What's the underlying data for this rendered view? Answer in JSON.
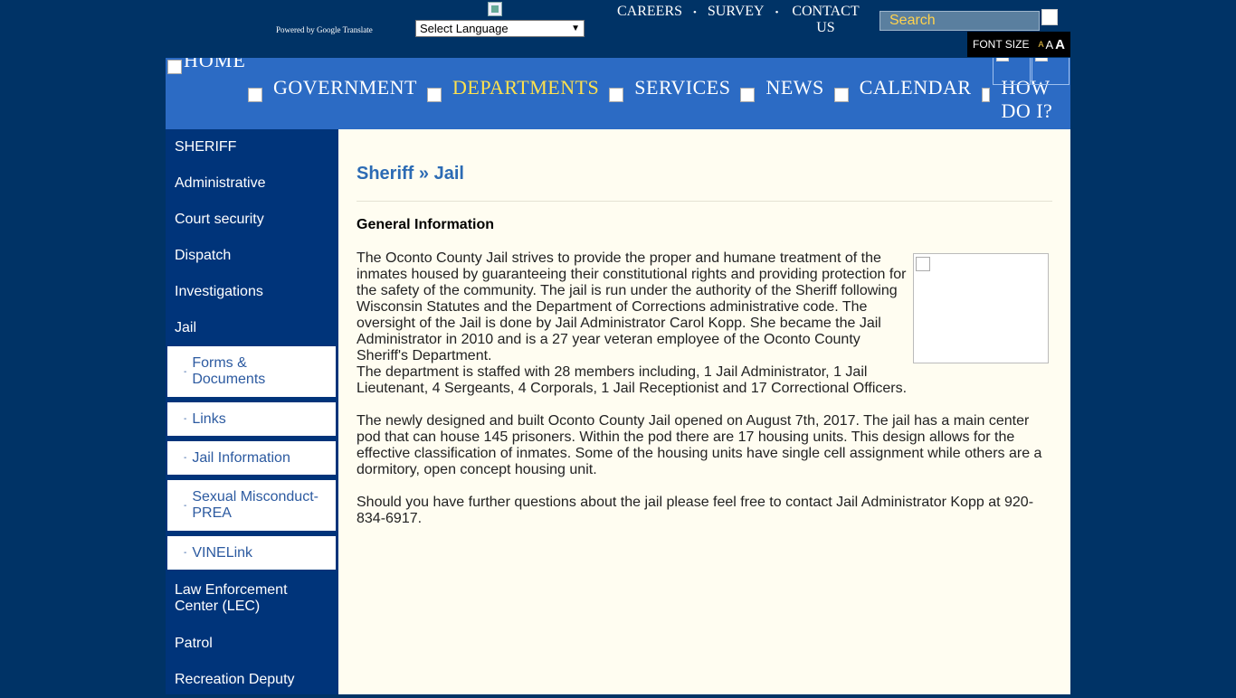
{
  "translate": {
    "powered_by": "Powered by Google Translate",
    "select_label": "Select Language"
  },
  "utility_nav": {
    "careers": "CAREERS",
    "survey": "SURVEY",
    "contact": "CONTACT US",
    "separator": "•"
  },
  "search": {
    "placeholder": "Search"
  },
  "font_size": {
    "label": "FONT SIZE",
    "small": "A",
    "medium": "A",
    "large": "A"
  },
  "main_nav": {
    "home": "HOME",
    "items": [
      {
        "label": "GOVERNMENT"
      },
      {
        "label": "DEPARTMENTS"
      },
      {
        "label": "SERVICES"
      },
      {
        "label": "NEWS"
      },
      {
        "label": "CALENDAR"
      },
      {
        "label": "HOW DO I?"
      }
    ]
  },
  "sidebar": {
    "items": [
      {
        "label": "SHERIFF"
      },
      {
        "label": "Administrative"
      },
      {
        "label": "Court security"
      },
      {
        "label": "Dispatch"
      },
      {
        "label": "Investigations"
      },
      {
        "label": "Jail"
      }
    ],
    "sub_items": [
      {
        "label": "Forms & Documents"
      },
      {
        "label": "Links"
      },
      {
        "label": "Jail Information"
      },
      {
        "label": "Sexual Misconduct-PREA"
      },
      {
        "label": "VINELink"
      }
    ],
    "more_items": [
      {
        "label": "Law Enforcement Center (LEC)"
      },
      {
        "label": "Patrol"
      },
      {
        "label": "Recreation Deputy"
      }
    ],
    "sub_dash": "-"
  },
  "content": {
    "breadcrumb": "Sheriff » Jail",
    "heading": "General Information",
    "paragraph1": "The Oconto County Jail strives to provide the proper and humane treatment of the inmates housed by guaranteeing their constitutional rights and providing protection for the safety of the community. The jail is run under the authority of the Sheriff following Wisconsin Statutes and the Department of Corrections administrative code. The oversight of the Jail is done by Jail Administrator Carol Kopp. She became the Jail Administrator in 2010 and is a 27 year veteran employee of the Oconto County Sheriff's Department.",
    "paragraph1b": "The department is staffed with 28 members including, 1 Jail Administrator, 1 Jail Lieutenant, 4 Sergeants, 4 Corporals, 1 Jail Receptionist and 17 Correctional Officers.",
    "paragraph2": "The newly designed and built Oconto County Jail opened on August 7th, 2017. The jail has a main center pod that can house 145 prisoners. Within the pod there are 17 housing units. This design allows for the effective classification of inmates. Some of the housing units have single cell assignment while others are a dormitory, open concept housing unit.",
    "paragraph3": "Should you have further questions about the jail please feel free to contact Jail Administrator Kopp at 920-834-6917."
  },
  "colors": {
    "page_bg": "#003366",
    "nav_bg": "#2c6bc4",
    "sidebar_bg": "#00347a",
    "content_bg": "#fffdf1",
    "active_nav": "#ffe14d",
    "breadcrumb": "#2c6bb4"
  }
}
